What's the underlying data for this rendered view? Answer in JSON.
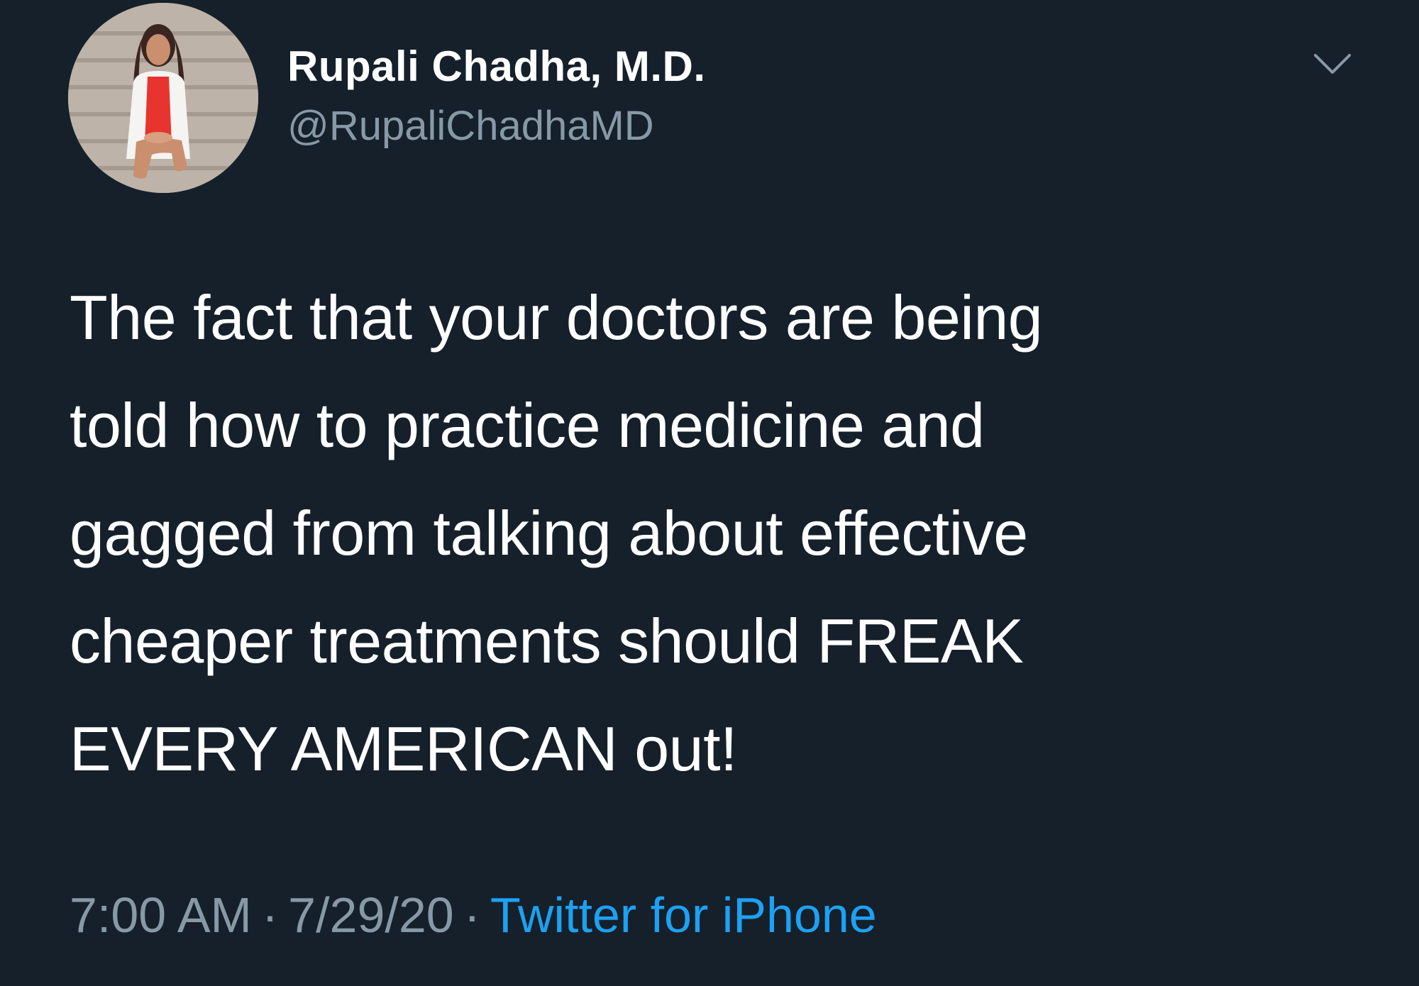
{
  "tweet": {
    "author": {
      "display_name": "Rupali Chadha, M.D.",
      "handle": "@RupaliChadhaMD"
    },
    "text_lines": [
      "The fact that your doctors are being",
      "told how to practice medicine and",
      "gagged from talking about effective",
      "cheaper treatments should FREAK",
      "EVERY AMERICAN out!"
    ],
    "time": "7:00 AM",
    "separator": "·",
    "date": "7/29/20",
    "source": "Twitter for iPhone"
  },
  "icons": {
    "menu": "chevron-down-icon"
  },
  "colors": {
    "background": "#15202b",
    "primary_text": "#ffffff",
    "secondary_text": "#8899a6",
    "accent": "#1da1f2"
  }
}
